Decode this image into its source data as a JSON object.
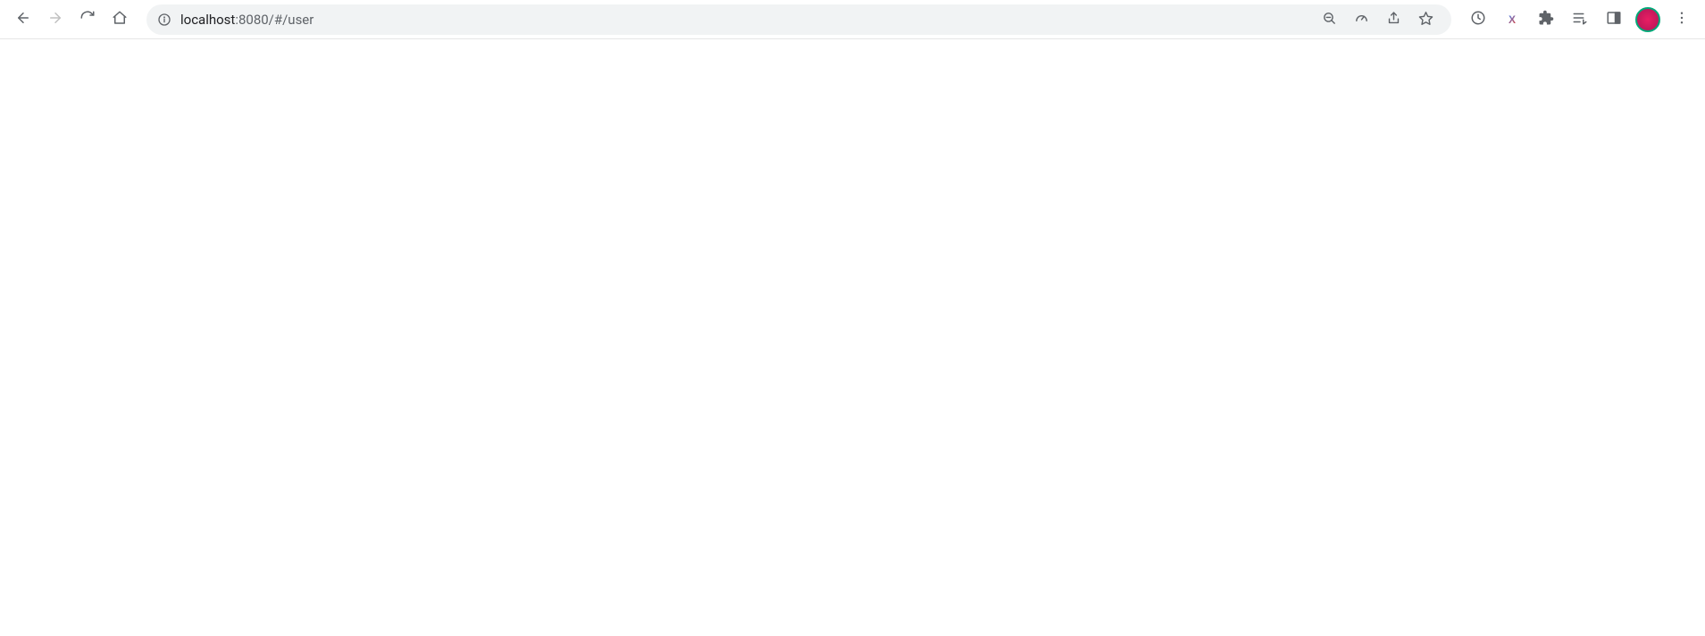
{
  "url": {
    "host": "localhost",
    "rest": ":8080/#/user"
  },
  "icons": {
    "back": "back-arrow",
    "forward": "forward-arrow",
    "reload": "reload",
    "home": "home",
    "site_info": "info",
    "zoom": "zoom-out",
    "performance": "speedometer",
    "share": "share",
    "bookmark": "star",
    "history": "clock",
    "ext_x": "X",
    "extensions": "puzzle",
    "reading_list": "reading-list",
    "side_panel": "side-panel",
    "menu": "dots-vertical"
  }
}
